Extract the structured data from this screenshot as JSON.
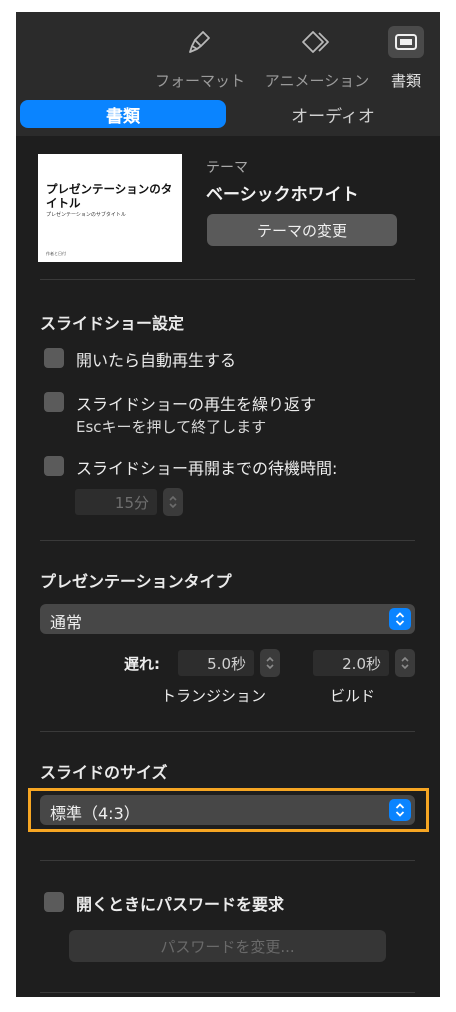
{
  "toolbar": {
    "format_label": "フォーマット",
    "animation_label": "アニメーション",
    "document_label": "書類"
  },
  "tabs": {
    "document": "書類",
    "audio": "オーディオ"
  },
  "theme": {
    "thumbnail_title": "プレゼンテーションのタイトル",
    "thumbnail_subtitle": "プレゼンテーションのサブタイトル",
    "thumbnail_footer": "作者と日付",
    "label": "テーマ",
    "name": "ベーシックホワイト",
    "change_button": "テーマの変更"
  },
  "slideshow": {
    "title": "スライドショー設定",
    "autoplay_label": "開いたら自動再生する",
    "loop_label": "スライドショーの再生を繰り返す",
    "loop_sublabel": "Escキーを押して終了します",
    "restart_label": "スライドショー再開までの待機時間:",
    "restart_value": "15分"
  },
  "presentation_type": {
    "title": "プレゼンテーションタイプ",
    "selected": "通常",
    "delay_label": "遅れ:",
    "transition_value": "5.0秒",
    "build_value": "2.0秒",
    "transition_caption": "トランジション",
    "build_caption": "ビルド"
  },
  "slide_size": {
    "title": "スライドのサイズ",
    "selected": "標準（4:3）"
  },
  "password": {
    "require_label": "開くときにパスワードを要求",
    "change_button": "パスワードを変更..."
  },
  "colors": {
    "accent": "#0a84ff",
    "highlight": "#f6a623",
    "panel_bg": "#1e1e1e"
  }
}
